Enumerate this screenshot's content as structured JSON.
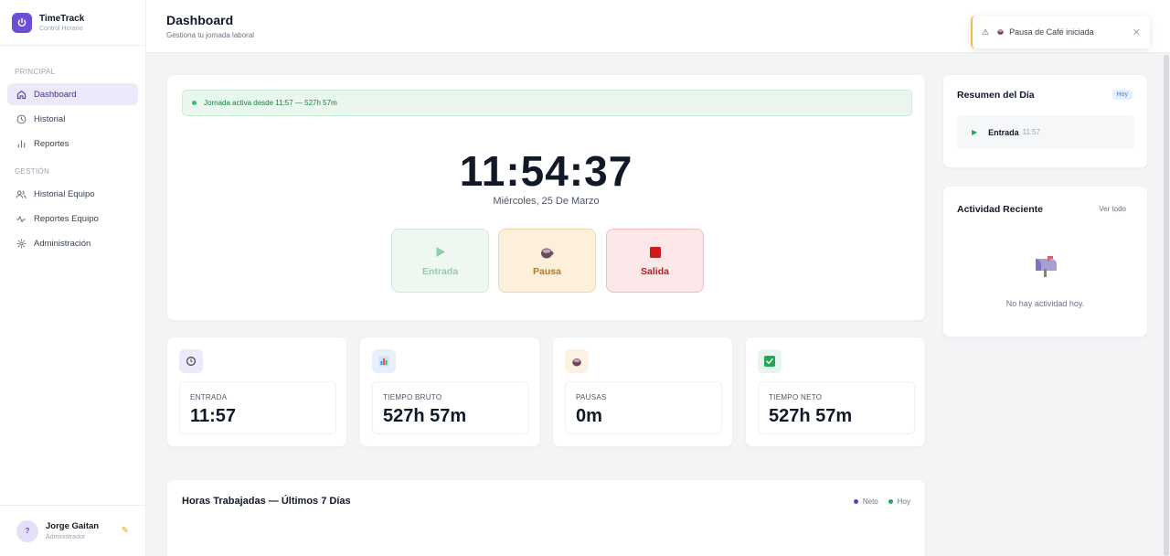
{
  "app": {
    "name": "TimeTrack",
    "subtitle": "Control Horario"
  },
  "sidebar": {
    "sections": [
      {
        "title": "PRINCIPAL",
        "items": [
          {
            "label": "Dashboard",
            "icon": "home-icon",
            "active": true
          },
          {
            "label": "Historial",
            "icon": "clock-icon"
          },
          {
            "label": "Reportes",
            "icon": "bar-chart-icon"
          }
        ]
      },
      {
        "title": "GESTIÓN",
        "items": [
          {
            "label": "Historial Equipo",
            "icon": "users-icon"
          },
          {
            "label": "Reportes Equipo",
            "icon": "activity-icon"
          },
          {
            "label": "Administración",
            "icon": "gear-icon"
          }
        ]
      }
    ],
    "user": {
      "initial": "?",
      "name": "Jorge Gaitan",
      "role": "Administrador"
    }
  },
  "header": {
    "title": "Dashboard",
    "subtitle": "Gestiona tu jornada laboral"
  },
  "toast": {
    "message": "Pausa de Café iniciada"
  },
  "timer": {
    "status": "Jornada activa desde 11:57 — 527h 57m",
    "clock": "11:54:37",
    "date": "Miércoles, 25 De Marzo",
    "actions": {
      "entrada": "Entrada",
      "pausa": "Pausa",
      "salida": "Salida"
    }
  },
  "stats": [
    {
      "label": "ENTRADA",
      "value": "11:57",
      "icon": "clock-icon",
      "bg": "#ede9fb"
    },
    {
      "label": "TIEMPO BRUTO",
      "value": "527h 57m",
      "icon": "bar-chart-icon",
      "bg": "#e6f0fb"
    },
    {
      "label": "PAUSAS",
      "value": "0m",
      "icon": "coffee-icon",
      "bg": "#fdf1e3"
    },
    {
      "label": "TIEMPO NETO",
      "value": "527h 57m",
      "icon": "check-icon",
      "bg": "#e6f6ec"
    }
  ],
  "chart": {
    "title": "Horas Trabajadas — Últimos 7 Días",
    "legend": [
      {
        "label": "Neto",
        "color": "#4f46b5"
      },
      {
        "label": "Hoy",
        "color": "#22a559"
      }
    ]
  },
  "summary": {
    "title": "Resumen del Día",
    "badge": "Hoy",
    "entry_label": "Entrada",
    "entry_time": "11:57"
  },
  "activity": {
    "title": "Actividad Reciente",
    "view_all": "Ver todo",
    "empty_text": "No hay actividad hoy."
  }
}
